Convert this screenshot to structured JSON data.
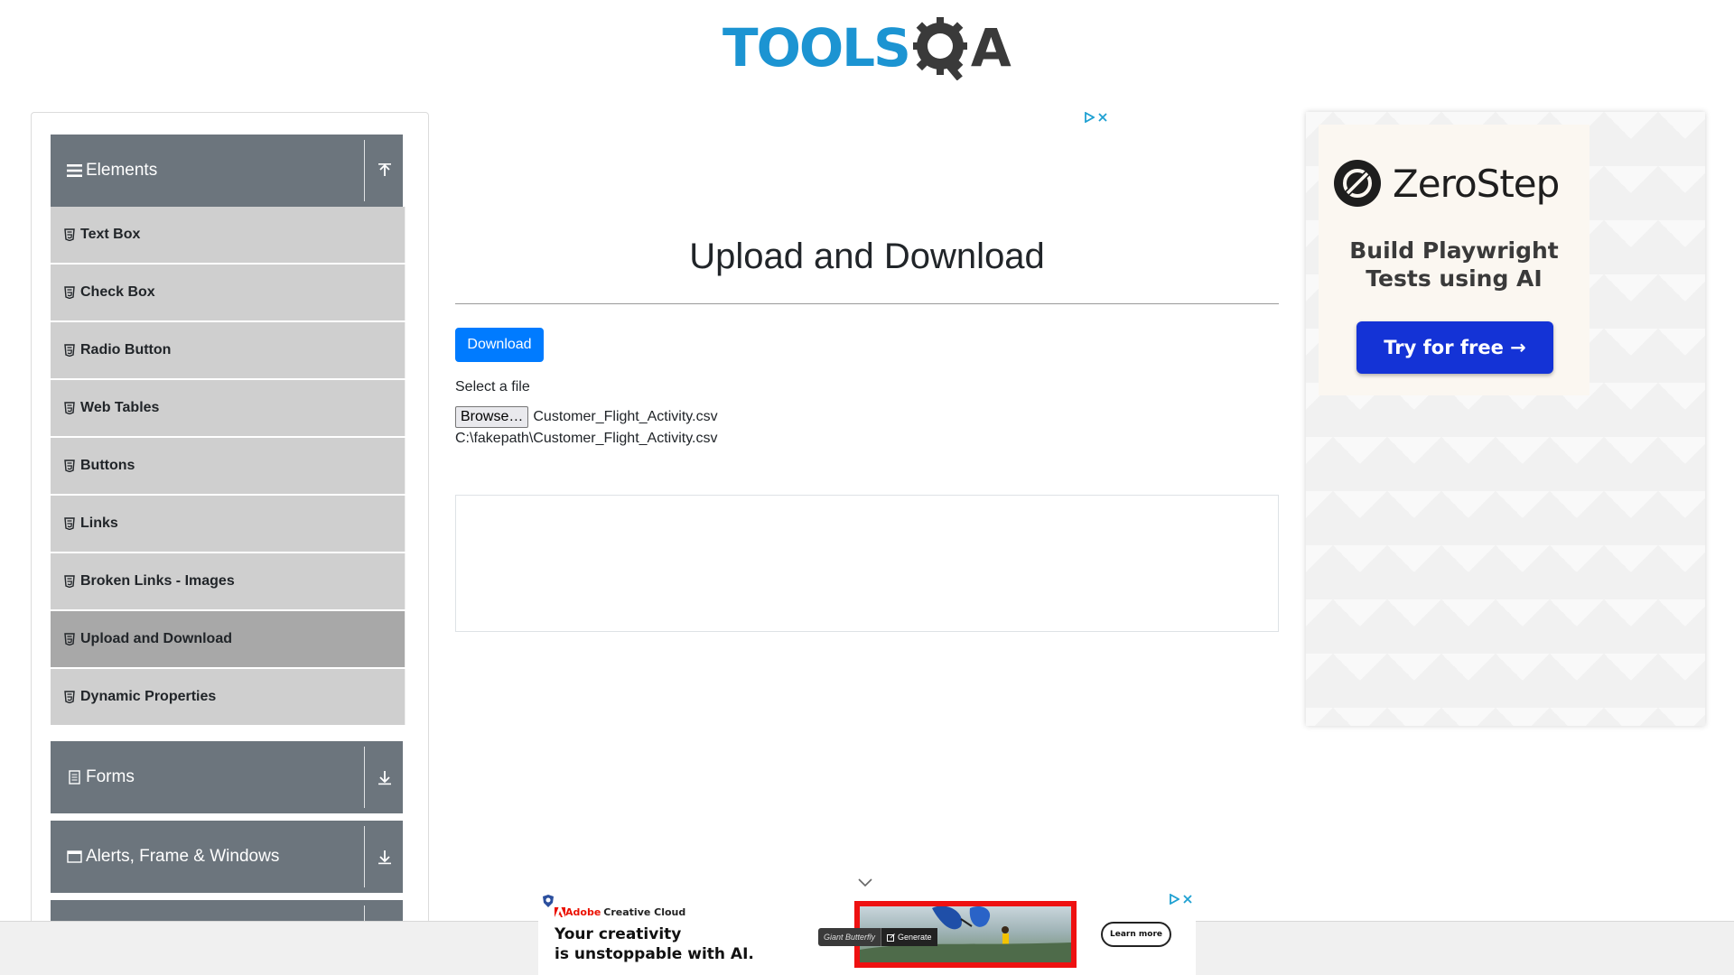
{
  "header": {
    "logo_tools": "TOOLS",
    "logo_a": "A",
    "brand_colors": {
      "tools": "#1c94d2",
      "qa": "#3a3a3a"
    }
  },
  "sidebar": {
    "groups": [
      {
        "title": "Elements",
        "icon": "hamburger-icon",
        "expanded": true,
        "toggle_icon": "collapse-arrow-icon"
      },
      {
        "title": "Forms",
        "icon": "form-icon",
        "expanded": false,
        "toggle_icon": "expand-arrow-icon"
      },
      {
        "title": "Alerts, Frame & Windows",
        "icon": "window-icon",
        "expanded": false,
        "toggle_icon": "expand-arrow-icon"
      }
    ],
    "items": [
      {
        "label": "Text Box",
        "icon": "html5-icon",
        "active": false
      },
      {
        "label": "Check Box",
        "icon": "html5-icon",
        "active": false
      },
      {
        "label": "Radio Button",
        "icon": "html5-icon",
        "active": false
      },
      {
        "label": "Web Tables",
        "icon": "html5-icon",
        "active": false
      },
      {
        "label": "Buttons",
        "icon": "html5-icon",
        "active": false
      },
      {
        "label": "Links",
        "icon": "html5-icon",
        "active": false
      },
      {
        "label": "Broken Links - Images",
        "icon": "html5-icon",
        "active": false
      },
      {
        "label": "Upload and Download",
        "icon": "html5-icon",
        "active": true
      },
      {
        "label": "Dynamic Properties",
        "icon": "html5-icon",
        "active": false
      }
    ]
  },
  "main": {
    "title": "Upload and Download",
    "download_label": "Download",
    "select_file_label": "Select a file",
    "browse_label": "Browse…",
    "file_name": "Customer_Flight_Activity.csv",
    "uploaded_path": "C:\\fakepath\\Customer_Flight_Activity.csv"
  },
  "right_ad": {
    "brand": "ZeroStep",
    "tagline_line1": "Build Playwright",
    "tagline_line2": "Tests using AI",
    "cta": "Try for free →",
    "cta_color": "#1433d6"
  },
  "bottom_ad": {
    "brand_adobe": "Adobe",
    "brand_product": "Creative Cloud",
    "headline_line1": "Your creativity",
    "headline_line2": "is unstoppable with AI.",
    "chip_text": "Giant Butterfly",
    "chip_action": "Generate",
    "learn_more": "Learn more",
    "accent_color": "#ee1111"
  },
  "colors": {
    "primary": "#007bff",
    "group_header_bg": "#6c757d",
    "menu_item_bg": "#cfcfcf",
    "menu_item_active_bg": "#a8a8a8"
  }
}
